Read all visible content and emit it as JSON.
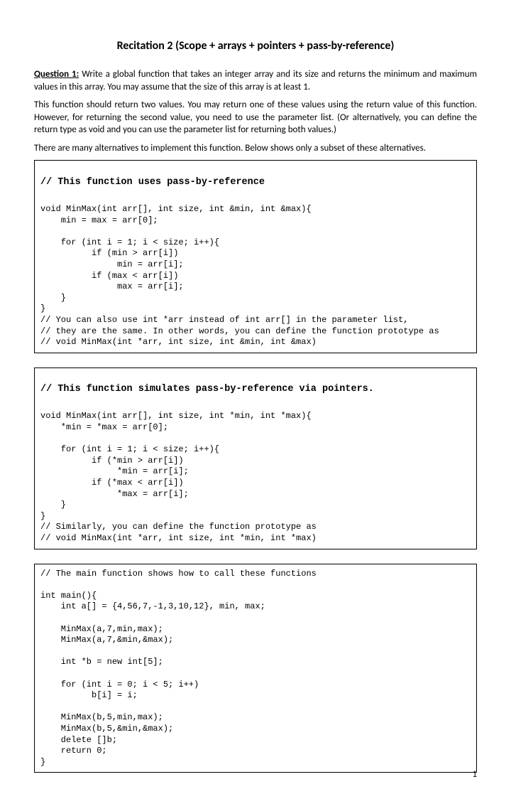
{
  "title": "Recitation 2 (Scope + arrays + pointers + pass-by-reference)",
  "question_label": "Question 1:",
  "para1_rest": " Write a global function that takes an integer array and its size and returns the minimum and maximum values in this array. You may assume that the size of this array is at least 1.",
  "para2": "This function should return two values. You may return one of these values using the return value of this function. However, for returning the second value, you need to use the parameter list. (Or alternatively, you can define the return type as void and you can use the parameter list for returning both values.)",
  "para3": "There are many alternatives to implement this function. Below shows only a subset of these alternatives.",
  "box1_header": "// This function uses pass-by-reference",
  "box1_code": "void MinMax(int arr[], int size, int &min, int &max){\n    min = max = arr[0];\n\n    for (int i = 1; i < size; i++){\n          if (min > arr[i])\n               min = arr[i];\n          if (max < arr[i])\n               max = arr[i];\n    }\n}\n// You can also use int *arr instead of int arr[] in the parameter list,\n// they are the same. In other words, you can define the function prototype as\n// void MinMax(int *arr, int size, int &min, int &max)\n",
  "box2_header": "// This function simulates pass-by-reference via pointers.",
  "box2_code": "void MinMax(int arr[], int size, int *min, int *max){\n    *min = *max = arr[0];\n\n    for (int i = 1; i < size; i++){\n          if (*min > arr[i])\n               *min = arr[i];\n          if (*max < arr[i])\n               *max = arr[i];\n    }\n}\n// Similarly, you can define the function prototype as\n// void MinMax(int *arr, int size, int *min, int *max)\n",
  "box3_code": "// The main function shows how to call these functions\n\nint main(){\n    int a[] = {4,56,7,-1,3,10,12}, min, max;\n\n    MinMax(a,7,min,max);\n    MinMax(a,7,&min,&max);\n\n    int *b = new int[5];\n\n    for (int i = 0; i < 5; i++)\n          b[i] = i;\n\n    MinMax(b,5,min,max);\n    MinMax(b,5,&min,&max);\n    delete []b;\n    return 0;\n}",
  "page_number": "1"
}
